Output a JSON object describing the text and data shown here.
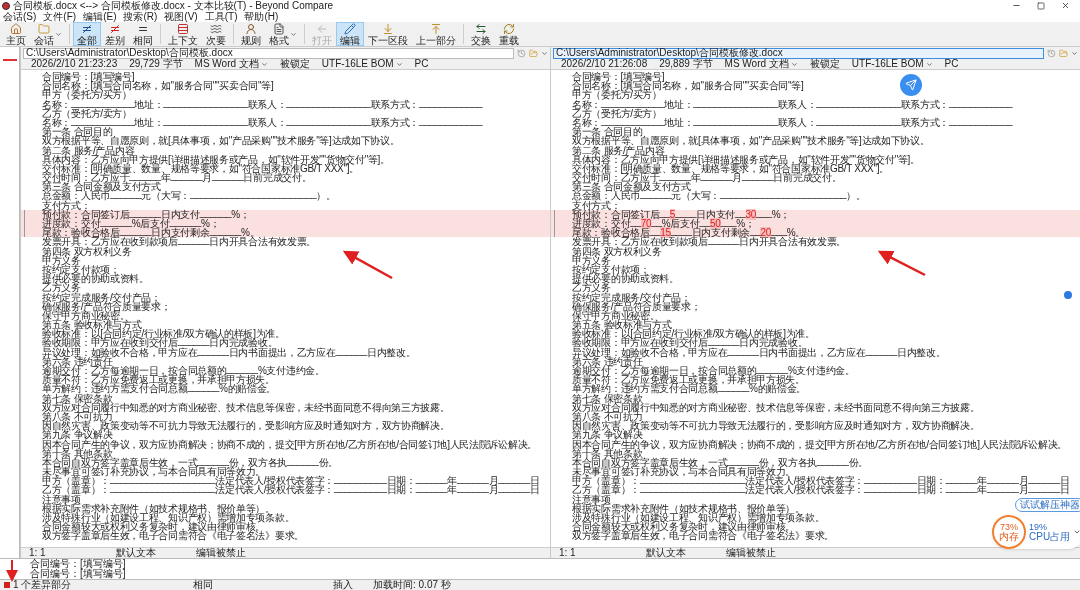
{
  "window": {
    "title": "合同模板.docx <--> 合同模板修改.docx - 文本比较(T) - Beyond Compare"
  },
  "menu": [
    "会话(S)",
    "文件(F)",
    "编辑(E)",
    "搜索(R)",
    "视图(V)",
    "工具(T)",
    "帮助(H)"
  ],
  "toolbar": [
    {
      "label": "主页",
      "selected": false,
      "disabled": false,
      "has_menu": false
    },
    {
      "label": "会话",
      "selected": false,
      "disabled": false,
      "has_menu": true
    },
    {
      "label": "全部",
      "selected": true,
      "disabled": false,
      "has_menu": false
    },
    {
      "label": "差别",
      "selected": false,
      "disabled": false,
      "has_menu": false
    },
    {
      "label": "相同",
      "selected": false,
      "disabled": false,
      "has_menu": false
    },
    {
      "label": "上下文",
      "selected": false,
      "disabled": false,
      "has_menu": false
    },
    {
      "label": "次要",
      "selected": false,
      "disabled": false,
      "has_menu": false
    },
    {
      "label": "规则",
      "selected": false,
      "disabled": false,
      "has_menu": false
    },
    {
      "label": "格式",
      "selected": false,
      "disabled": false,
      "has_menu": true
    },
    {
      "label": "打开",
      "selected": false,
      "disabled": true,
      "has_menu": false
    },
    {
      "label": "编辑",
      "selected": true,
      "disabled": false,
      "has_menu": false
    },
    {
      "label": "下一区段",
      "selected": false,
      "disabled": false,
      "has_menu": false
    },
    {
      "label": "上一部分",
      "selected": false,
      "disabled": false,
      "has_menu": false
    },
    {
      "label": "交换",
      "selected": false,
      "disabled": false,
      "has_menu": false
    },
    {
      "label": "重载",
      "selected": false,
      "disabled": false,
      "has_menu": false
    }
  ],
  "panes": [
    {
      "path": "C:\\Users\\Administrator\\Desktop\\合同模板.docx",
      "focused": false,
      "date": "2026/2/10 21:23:23",
      "size": "29,729 字节",
      "format": "MS Word 文档",
      "lock": "被锁定",
      "encoding": "UTF-16LE BOM",
      "line_end": "PC",
      "cursor": "1: 1",
      "text_type": "默认文本",
      "edit_state": "编辑被禁止",
      "lines": [
        {
          "text": "合同编号：[填写编号]",
          "diff": false
        },
        {
          "text": "合同名称：[填写合同名称，如\"服务合同\"\"买卖合同\"等]",
          "diff": false
        },
        {
          "text": "甲方（委托方/买方）",
          "diff": false
        },
        {
          "text": "名称：____________地址：________________联系人：________________联系方式：____________",
          "diff": false
        },
        {
          "text": "乙方（受托方/卖方）",
          "diff": false
        },
        {
          "text": "名称：____________地址：________________联系人：________________联系方式：____________",
          "diff": false
        },
        {
          "text": "第一条 合同目的",
          "diff": false
        },
        {
          "text": "双方根据平等、自愿原则，就[具体事项，如\"产品采购\"\"技术服务\"等]达成如下协议。",
          "diff": false
        },
        {
          "text": "第二条 服务/产品内容",
          "diff": false
        },
        {
          "text": "具体内容：乙方应向甲方提供[详细描述服务或产品，如\"软件开发\"\"货物交付\"等]。",
          "diff": false
        },
        {
          "text": "交付标准：[明确质量、数量、规格等要求，如\"符合国家标准GB/T XXX\"]。",
          "diff": false
        },
        {
          "text": "交付时间：乙方应于______年______月______日前完成交付。",
          "diff": false
        },
        {
          "text": "第三条 合同金额及支付方式",
          "diff": false
        },
        {
          "text": "总金额：人民币______元（大写：________________________）。",
          "diff": false
        },
        {
          "text": "支付方式：",
          "diff": false
        },
        {
          "text": "预付款：合同签订后______日内支付______%；",
          "diff": true
        },
        {
          "text": "进度款：交付______%后支付______%；",
          "diff": true
        },
        {
          "text": "尾款：验收合格后______日内支付剩余______%。",
          "diff": true
        },
        {
          "text": "发票开具：乙方应在收到款项后______日内开具合法有效发票。",
          "diff": false
        },
        {
          "text": "第四条 双方权利义务",
          "diff": false
        },
        {
          "text": "甲方义务",
          "diff": false
        },
        {
          "text": "按约定支付款项；",
          "diff": false
        },
        {
          "text": "提供必要的协助或资料。",
          "diff": false
        },
        {
          "text": "乙方义务",
          "diff": false
        },
        {
          "text": "按约定完成服务/交付产品；",
          "diff": false
        },
        {
          "text": "确保服务/产品符合质量要求；",
          "diff": false
        },
        {
          "text": "保守甲方商业秘密。",
          "diff": false
        },
        {
          "text": "第五条 验收标准与方式",
          "diff": false
        },
        {
          "text": "验收标准：以[合同约定/行业标准/双方确认的样板]为准。",
          "diff": false
        },
        {
          "text": "验收期限：甲方应在收到交付后______日内完成验收。",
          "diff": false
        },
        {
          "text": "异议处理：如验收不合格，甲方应在______日内书面提出，乙方应在______日内整改。",
          "diff": false
        },
        {
          "text": "第六条 违约责任",
          "diff": false
        },
        {
          "text": "逾期交付：乙方每逾期一日，按合同总额的______%支付违约金。",
          "diff": false
        },
        {
          "text": "质量不符：乙方应免费返工或更换，并承担甲方损失。",
          "diff": false
        },
        {
          "text": "单方解约：违约方需支付合同总额______%的赔偿金。",
          "diff": false
        },
        {
          "text": "第七条 保密条款",
          "diff": false
        },
        {
          "text": "双方应对合同履行中知悉的对方商业秘密、技术信息等保密，未经书面同意不得向第三方披露。",
          "diff": false
        },
        {
          "text": "第八条 不可抗力",
          "diff": false
        },
        {
          "text": "因自然灾害、政策变动等不可抗力导致无法履行的，受影响方应及时通知对方，双方协商解决。",
          "diff": false
        },
        {
          "text": "第九条 争议解决",
          "diff": false
        },
        {
          "text": "因本合同产生的争议，双方应协商解决；协商不成的，提交[甲方所在地/乙方所在地/合同签订地]人民法院诉讼解决。",
          "diff": false
        },
        {
          "text": "第十条 其他条款",
          "diff": false
        },
        {
          "text": "本合同自双方签字盖章后生效，一式______份，双方各执______份。",
          "diff": false
        },
        {
          "text": "未尽事宜可签订补充协议，与本合同具有同等效力。",
          "diff": false
        },
        {
          "text": "甲方（盖章）：____________________法定代表人/授权代表签字：__________日期：______年______月______日",
          "diff": false
        },
        {
          "text": "乙方（盖章）：____________________法定代表人/授权代表签字：__________日期：______年______月______日",
          "diff": false
        },
        {
          "text": "注意事项",
          "diff": false
        },
        {
          "text": "根据实际需求补充附件（如技术规格书、报价单等）。",
          "diff": false
        },
        {
          "text": "涉及特殊行业（如建设工程、知识产权）需增加专项条款。",
          "diff": false
        },
        {
          "text": "合同金额较大或权利义务复杂时，建议由律师审核。",
          "diff": false
        },
        {
          "text": "双方签字盖章后生效，电子合同需符合《电子签名法》要求。",
          "diff": false
        }
      ]
    },
    {
      "path": "C:\\Users\\Administrator\\Desktop\\合同模板修改.docx",
      "focused": true,
      "date": "2026/2/10 21:26:08",
      "size": "29,889 字节",
      "format": "MS Word 文档",
      "lock": "被锁定",
      "encoding": "UTF-16LE BOM",
      "line_end": "PC",
      "cursor": "1: 1",
      "text_type": "默认文本",
      "edit_state": "编辑被禁止",
      "lines": [
        {
          "text": "合同编号：[填写编号]",
          "diff": false
        },
        {
          "text": "合同名称：[填写合同名称，如\"服务合同\"\"买卖合同\"等]",
          "diff": false
        },
        {
          "text": "甲方（委托方/买方）",
          "diff": false
        },
        {
          "text": "名称：____________地址：________________联系人：________________联系方式：____________",
          "diff": false
        },
        {
          "text": "乙方（受托方/卖方）",
          "diff": false
        },
        {
          "text": "名称：____________地址：________________联系人：________________联系方式：____________",
          "diff": false
        },
        {
          "text": "第一条 合同目的",
          "diff": false
        },
        {
          "text": "双方根据平等、自愿原则，就[具体事项，如\"产品采购\"\"技术服务\"等]达成如下协议。",
          "diff": false
        },
        {
          "text": "第二条 服务/产品内容",
          "diff": false
        },
        {
          "text": "具体内容：乙方应向甲方提供[详细描述服务或产品，如\"软件开发\"\"货物交付\"等]。",
          "diff": false
        },
        {
          "text": "交付标准：[明确质量、数量、规格等要求，如\"符合国家标准GB/T XXX\"]。",
          "diff": false
        },
        {
          "text": "交付时间：乙方应于______年______月______日前完成交付。",
          "diff": false
        },
        {
          "text": "第三条 合同金额及支付方式",
          "diff": false
        },
        {
          "text": "总金额：人民币______元（大写：________________________）。",
          "diff": false
        },
        {
          "text": "支付方式：",
          "diff": false
        },
        {
          "diff": true,
          "segments": [
            {
              "text": "预付款：合同签订后__",
              "changed": false
            },
            {
              "text": "5",
              "changed": true
            },
            {
              "text": "____日内支付__",
              "changed": false
            },
            {
              "text": "30",
              "changed": true
            },
            {
              "text": "___%；",
              "changed": false
            }
          ]
        },
        {
          "diff": true,
          "segments": [
            {
              "text": "进度款：交付__",
              "changed": false
            },
            {
              "text": "70",
              "changed": true
            },
            {
              "text": "__%后支付__",
              "changed": false
            },
            {
              "text": "50",
              "changed": true
            },
            {
              "text": "___%；",
              "changed": false
            }
          ]
        },
        {
          "diff": true,
          "segments": [
            {
              "text": "尾款：验收合格后__",
              "changed": false
            },
            {
              "text": "15",
              "changed": true
            },
            {
              "text": "____日内支付剩余__",
              "changed": false
            },
            {
              "text": "20",
              "changed": true
            },
            {
              "text": "___%。",
              "changed": false
            }
          ]
        },
        {
          "text": "发票开具：乙方应在收到款项后______日内开具合法有效发票。",
          "diff": false
        },
        {
          "text": "第四条 双方权利义务",
          "diff": false
        },
        {
          "text": "甲方义务",
          "diff": false
        },
        {
          "text": "按约定支付款项；",
          "diff": false
        },
        {
          "text": "提供必要的协助或资料。",
          "diff": false
        },
        {
          "text": "乙方义务",
          "diff": false
        },
        {
          "text": "按约定完成服务/交付产品；",
          "diff": false
        },
        {
          "text": "确保服务/产品符合质量要求；",
          "diff": false
        },
        {
          "text": "保守甲方商业秘密。",
          "diff": false
        },
        {
          "text": "第五条 验收标准与方式",
          "diff": false
        },
        {
          "text": "验收标准：以[合同约定/行业标准/双方确认的样板]为准。",
          "diff": false
        },
        {
          "text": "验收期限：甲方应在收到交付后______日内完成验收。",
          "diff": false
        },
        {
          "text": "异议处理：如验收不合格，甲方应在______日内书面提出，乙方应在______日内整改。",
          "diff": false
        },
        {
          "text": "第六条 违约责任",
          "diff": false
        },
        {
          "text": "逾期交付：乙方每逾期一日，按合同总额的______%支付违约金。",
          "diff": false
        },
        {
          "text": "质量不符：乙方应免费返工或更换，并承担甲方损失。",
          "diff": false
        },
        {
          "text": "单方解约：违约方需支付合同总额______%的赔偿金。",
          "diff": false
        },
        {
          "text": "第七条 保密条款",
          "diff": false
        },
        {
          "text": "双方应对合同履行中知悉的对方商业秘密、技术信息等保密，未经书面同意不得向第三方披露。",
          "diff": false
        },
        {
          "text": "第八条 不可抗力",
          "diff": false
        },
        {
          "text": "因自然灾害、政策变动等不可抗力导致无法履行的，受影响方应及时通知对方，双方协商解决。",
          "diff": false
        },
        {
          "text": "第九条 争议解决",
          "diff": false
        },
        {
          "text": "因本合同产生的争议，双方应协商解决；协商不成的，提交[甲方所在地/乙方所在地/合同签订地]人民法院诉讼解决。",
          "diff": false
        },
        {
          "text": "第十条 其他条款",
          "diff": false
        },
        {
          "text": "本合同自双方签字盖章后生效，一式______份，双方各执______份。",
          "diff": false
        },
        {
          "text": "未尽事宜可签订补充协议，与本合同具有同等效力。",
          "diff": false
        },
        {
          "text": "甲方（盖章）：____________________法定代表人/授权代表签字：__________日期：______年______月______日",
          "diff": false
        },
        {
          "text": "乙方（盖章）：____________________法定代表人/授权代表签字：__________日期：______年______月______日",
          "diff": false
        },
        {
          "text": "注意事项",
          "diff": false
        },
        {
          "text": "根据实际需求补充附件（如技术规格书、报价单等）。",
          "diff": false
        },
        {
          "text": "涉及特殊行业（如建设工程、知识产权）需增加专项条款。",
          "diff": false
        },
        {
          "text": "合同金额较大或权利义务复杂时，建议由律师审核。",
          "diff": false
        },
        {
          "text": "双方签字盖章后生效，电子合同需符合《电子签名法》要求。",
          "diff": false
        }
      ]
    }
  ],
  "detail_lines": [
    "合同编号：[填写编号]",
    "合同编号：[填写编号]"
  ],
  "status_bar": {
    "differences": "1 个差异部分",
    "compare": "相同",
    "mode": "插入",
    "load_time": "加载时间: 0.07 秒"
  },
  "widget": {
    "pill": "试试解压神器",
    "memory": "73%",
    "memory_label": "内存",
    "cpu": "19%",
    "cpu_label": "CPU占用"
  }
}
